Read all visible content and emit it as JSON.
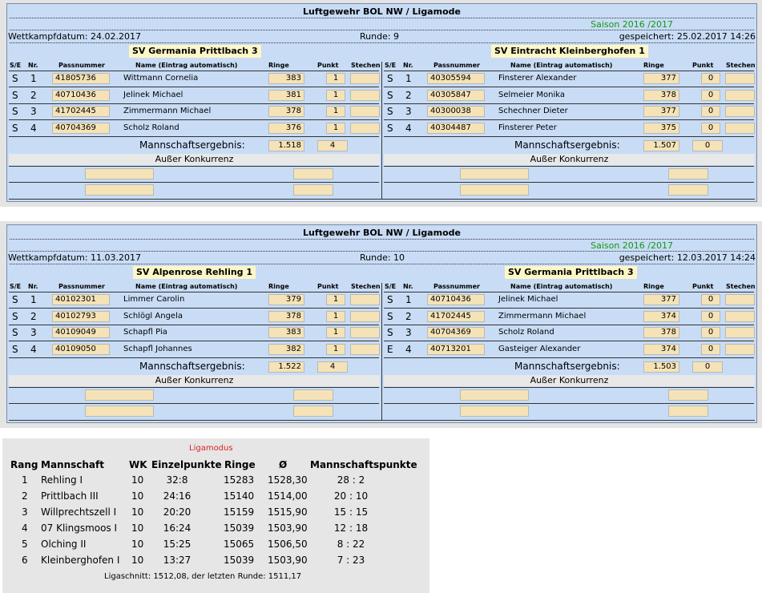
{
  "panels": [
    {
      "title": "Luftgewehr BOL NW / Ligamode",
      "saison": "Saison 2016 /2017",
      "datum": "Wettkampfdatum: 24.02.2017",
      "runde": "Runde: 9",
      "gespeichert": "gespeichert: 25.02.2017 14:26",
      "columns": {
        "se": "S/E",
        "nr": "Nr.",
        "pass": "Passnummer",
        "name": "Name (Eintrag automatisch)",
        "ringe": "Ringe",
        "punkt": "Punkt",
        "stechen": "Stechen"
      },
      "ergebnis_label": "Mannschaftsergebnis:",
      "ausser_label": "Außer Konkurrenz",
      "teams": [
        {
          "name": "SV Germania Prittlbach 3",
          "result": "1.518",
          "punkte": "4",
          "rows": [
            {
              "se": "S",
              "nr": "1",
              "pass": "41805736",
              "name": "Wittmann Cornelia",
              "ringe": "383",
              "punkt": "1"
            },
            {
              "se": "S",
              "nr": "2",
              "pass": "40710436",
              "name": "Jelinek Michael",
              "ringe": "381",
              "punkt": "1"
            },
            {
              "se": "S",
              "nr": "3",
              "pass": "41702445",
              "name": "Zimmermann Michael",
              "ringe": "378",
              "punkt": "1"
            },
            {
              "se": "S",
              "nr": "4",
              "pass": "40704369",
              "name": "Scholz Roland",
              "ringe": "376",
              "punkt": "1"
            }
          ]
        },
        {
          "name": "SV Eintracht Kleinberghofen 1",
          "result": "1.507",
          "punkte": "0",
          "rows": [
            {
              "se": "S",
              "nr": "1",
              "pass": "40305594",
              "name": "Finsterer Alexander",
              "ringe": "377",
              "punkt": "0"
            },
            {
              "se": "S",
              "nr": "2",
              "pass": "40305847",
              "name": "Selmeier Monika",
              "ringe": "378",
              "punkt": "0"
            },
            {
              "se": "S",
              "nr": "3",
              "pass": "40300038",
              "name": "Schechner Dieter",
              "ringe": "377",
              "punkt": "0"
            },
            {
              "se": "S",
              "nr": "4",
              "pass": "40304487",
              "name": "Finsterer Peter",
              "ringe": "375",
              "punkt": "0"
            }
          ]
        }
      ]
    },
    {
      "title": "Luftgewehr BOL NW / Ligamode",
      "saison": "Saison 2016 /2017",
      "datum": "Wettkampfdatum: 11.03.2017",
      "runde": "Runde: 10",
      "gespeichert": "gespeichert: 12.03.2017 14:24",
      "columns": {
        "se": "S/E",
        "nr": "Nr.",
        "pass": "Passnummer",
        "name": "Name (Eintrag automatisch)",
        "ringe": "Ringe",
        "punkt": "Punkt",
        "stechen": "Stechen"
      },
      "ergebnis_label": "Mannschaftsergebnis:",
      "ausser_label": "Außer Konkurrenz",
      "teams": [
        {
          "name": "SV Alpenrose Rehling 1",
          "result": "1.522",
          "punkte": "4",
          "rows": [
            {
              "se": "S",
              "nr": "1",
              "pass": "40102301",
              "name": "Limmer Carolin",
              "ringe": "379",
              "punkt": "1"
            },
            {
              "se": "S",
              "nr": "2",
              "pass": "40102793",
              "name": "Schlögl Angela",
              "ringe": "378",
              "punkt": "1"
            },
            {
              "se": "S",
              "nr": "3",
              "pass": "40109049",
              "name": "Schapfl Pia",
              "ringe": "383",
              "punkt": "1"
            },
            {
              "se": "S",
              "nr": "4",
              "pass": "40109050",
              "name": "Schapfl Johannes",
              "ringe": "382",
              "punkt": "1"
            }
          ]
        },
        {
          "name": "SV Germania Prittlbach 3",
          "result": "1.503",
          "punkte": "0",
          "rows": [
            {
              "se": "S",
              "nr": "1",
              "pass": "40710436",
              "name": "Jelinek Michael",
              "ringe": "377",
              "punkt": "0"
            },
            {
              "se": "S",
              "nr": "2",
              "pass": "41702445",
              "name": "Zimmermann Michael",
              "ringe": "374",
              "punkt": "0"
            },
            {
              "se": "S",
              "nr": "3",
              "pass": "40704369",
              "name": "Scholz Roland",
              "ringe": "378",
              "punkt": "0"
            },
            {
              "se": "E",
              "nr": "4",
              "pass": "40713201",
              "name": "Gasteiger Alexander",
              "ringe": "374",
              "punkt": "0"
            }
          ]
        }
      ]
    }
  ],
  "liga": {
    "title": "Ligamodus",
    "headers": [
      "Rang",
      "Mannschaft",
      "WK",
      "Einzelpunkte",
      "Ringe",
      "Ø",
      "Mannschaftspunkte"
    ],
    "rows": [
      [
        "1",
        "Rehling I",
        "10",
        "32:8",
        "15283",
        "1528,30",
        "28 : 2"
      ],
      [
        "2",
        "Prittlbach III",
        "10",
        "24:16",
        "15140",
        "1514,00",
        "20 : 10"
      ],
      [
        "3",
        "Willprechtszell I",
        "10",
        "20:20",
        "15159",
        "1515,90",
        "15 : 15"
      ],
      [
        "4",
        "07 Klingsmoos I",
        "10",
        "16:24",
        "15039",
        "1503,90",
        "12 : 18"
      ],
      [
        "5",
        "Olching II",
        "10",
        "15:25",
        "15065",
        "1506,50",
        "8 : 22"
      ],
      [
        "6",
        "Kleinberghofen I",
        "10",
        "13:27",
        "15039",
        "1503,90",
        "7 : 23"
      ]
    ],
    "footer": "Ligaschnitt: 1512,08, der letzten Runde: 1511,17"
  }
}
